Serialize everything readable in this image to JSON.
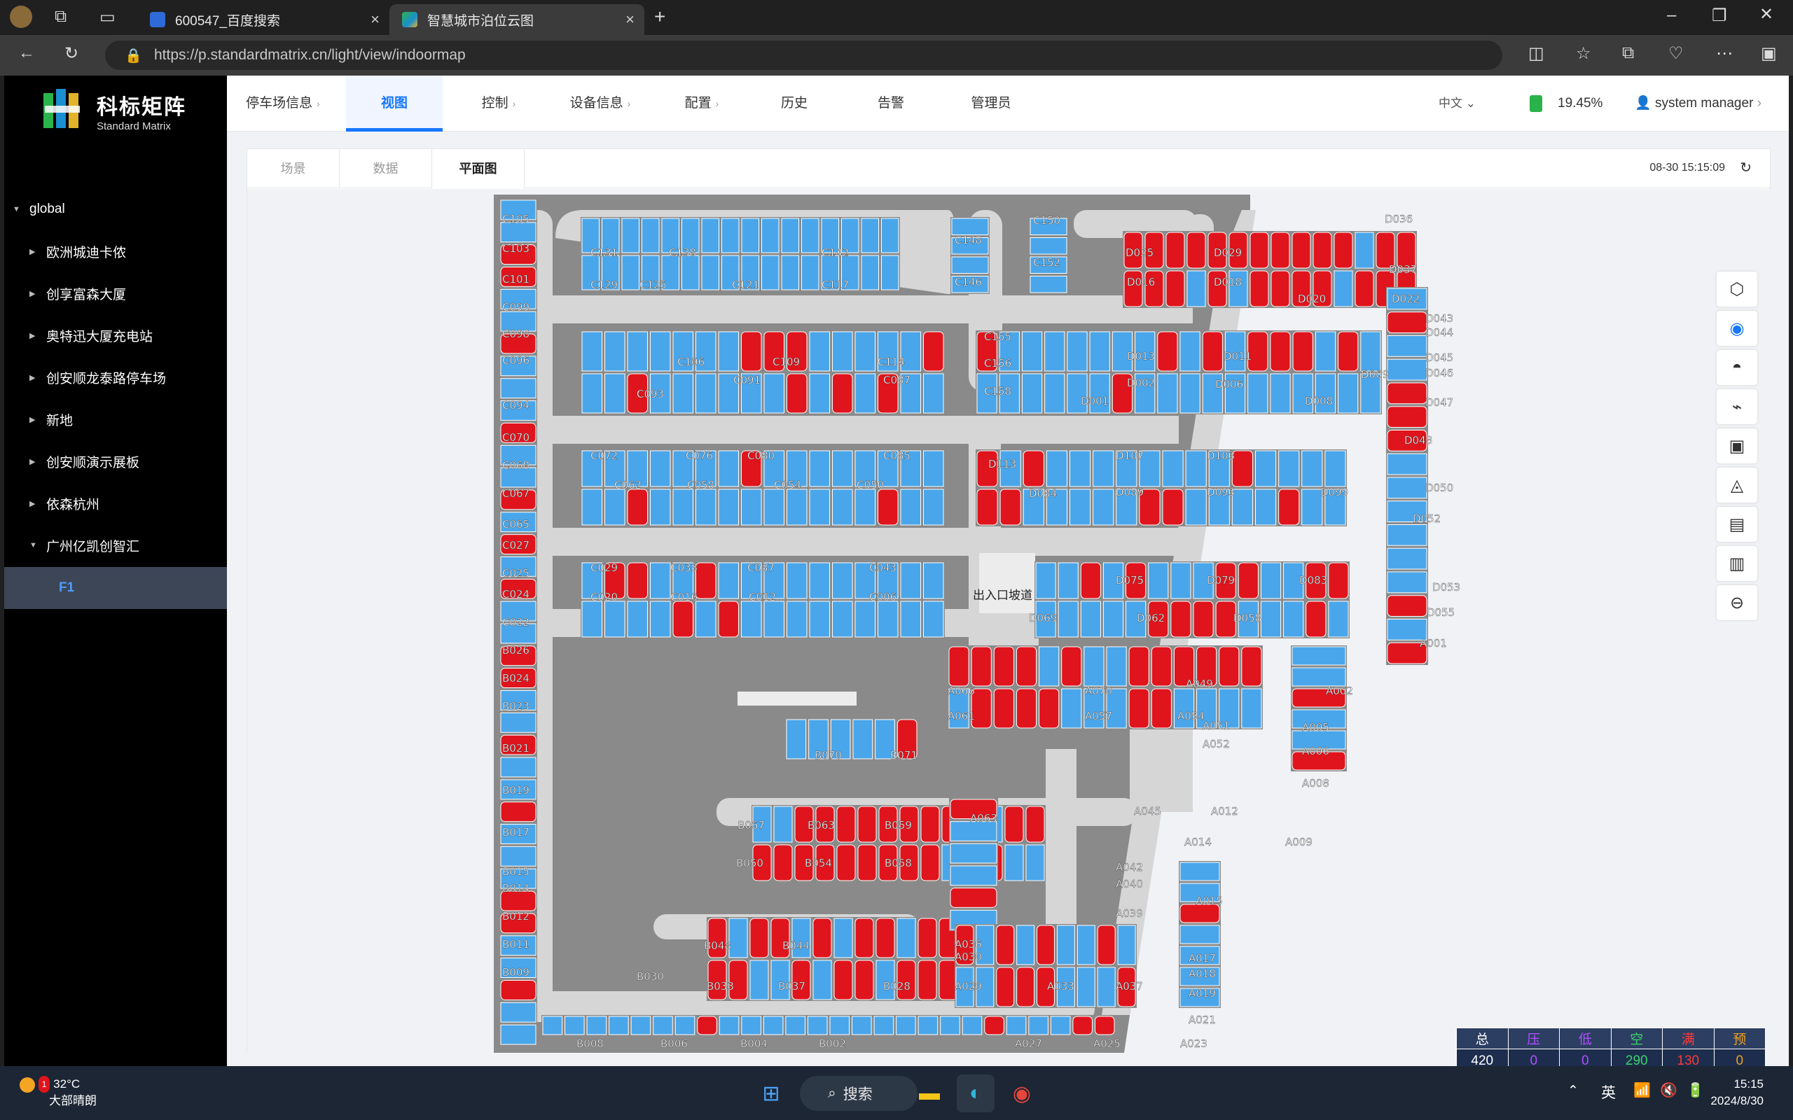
{
  "browser": {
    "tabs": [
      {
        "title": "600547_百度搜索"
      },
      {
        "title": "智慧城市泊位云图"
      }
    ],
    "url": "https://p.standardmatrix.cn/light/view/indoormap"
  },
  "logo": {
    "cn": "科标矩阵",
    "en": "Standard Matrix"
  },
  "sidebar": {
    "root": "global",
    "items": [
      {
        "label": "欧洲城迪卡侬"
      },
      {
        "label": "创享富森大厦"
      },
      {
        "label": "奥特迅大厦充电站"
      },
      {
        "label": "创安顺龙泰路停车场"
      },
      {
        "label": "新地"
      },
      {
        "label": "创安顺演示展板"
      },
      {
        "label": "依森杭州"
      },
      {
        "label": "广州亿凯创智汇"
      }
    ],
    "selected_child": "F1"
  },
  "topnav": {
    "items": [
      {
        "label": "停车场信息",
        "arrow": "›"
      },
      {
        "label": "视图",
        "arrow": ""
      },
      {
        "label": "控制",
        "arrow": "›"
      },
      {
        "label": "设备信息",
        "arrow": "›"
      },
      {
        "label": "配置",
        "arrow": "›"
      },
      {
        "label": "历史",
        "arrow": ""
      },
      {
        "label": "告警",
        "arrow": ""
      },
      {
        "label": "管理员",
        "arrow": ""
      }
    ],
    "lang": "中文",
    "battery": "19.45%",
    "user": "system manager"
  },
  "subtabs": [
    "场景",
    "数据",
    "平面图"
  ],
  "timestamp": "08-30 15:15:09",
  "map": {
    "ramp_label": "出入口坡道",
    "colors": {
      "occupied": "#e0141c",
      "vacant": "#4aa6ea",
      "lane": "#d6d6d6",
      "block": "#8a8a8a"
    },
    "space_labels": [
      "C105",
      "C103",
      "C101",
      "C099",
      "C098",
      "C096",
      "C094",
      "C070",
      "C068",
      "C067",
      "C065",
      "C027",
      "C025",
      "C024",
      "C022",
      "B026",
      "B024",
      "B023",
      "B021",
      "B019",
      "B017",
      "B015",
      "B014",
      "B012",
      "B011",
      "B009",
      "C131",
      "C129",
      "C138",
      "C125",
      "C121",
      "C142",
      "C117",
      "C148",
      "C146",
      "C150",
      "C152",
      "C106",
      "C109",
      "C114",
      "C093",
      "C091",
      "C087",
      "C072",
      "C062",
      "C076",
      "C058",
      "C080",
      "C054",
      "C085",
      "C050",
      "C029",
      "C020",
      "C033",
      "C016",
      "C037",
      "C012",
      "C043",
      "C006",
      "C155",
      "C156",
      "C158",
      "D025",
      "D016",
      "D029",
      "D018",
      "D036",
      "D037",
      "D020",
      "D022",
      "D013",
      "D011",
      "D002",
      "D006",
      "D001",
      "D008",
      "D009",
      "D113",
      "D107",
      "D103",
      "D084",
      "D089",
      "D093",
      "D099",
      "D075",
      "D079",
      "D083",
      "D069",
      "D062",
      "D058",
      "D043",
      "D044",
      "D045",
      "D046",
      "D047",
      "D048",
      "D050",
      "D052",
      "D053",
      "D055",
      "A001",
      "A002",
      "A005",
      "A006",
      "A008",
      "A066",
      "A070",
      "A049",
      "A061",
      "A057",
      "A054",
      "A051",
      "A052",
      "A063",
      "A045",
      "A012",
      "A014",
      "A009",
      "A042",
      "A040",
      "A015",
      "A039",
      "A036",
      "A030",
      "A029",
      "A033",
      "A037",
      "A017",
      "A018",
      "A019",
      "A021",
      "A023",
      "A025",
      "A027",
      "B070",
      "B071",
      "B067",
      "B063",
      "B059",
      "B050",
      "B054",
      "B058",
      "B048",
      "B044",
      "B030",
      "B033",
      "B037",
      "B028",
      "B008",
      "B006",
      "B004",
      "B002"
    ]
  },
  "tools": [
    "3d-view-icon",
    "eye-icon",
    "camera-dome-icon",
    "camera-bullet-icon",
    "screen-icon",
    "lamp-icon",
    "guide-screen-icon",
    "controller-icon",
    "car-icon"
  ],
  "stats": {
    "headers": [
      "总",
      "压",
      "低",
      "空",
      "满",
      "预"
    ],
    "values": [
      "420",
      "0",
      "0",
      "290",
      "130",
      "0"
    ],
    "colors": [
      "#ffffff",
      "#b24fff",
      "#b24fff",
      "#3cd56a",
      "#ff3a3a",
      "#f0a020"
    ]
  },
  "taskbar": {
    "weather_temp": "32°C",
    "weather_desc": "大部晴朗",
    "weather_badge": "1",
    "search_label": "搜索",
    "ime": "英",
    "time": "15:15",
    "date": "2024/8/30"
  }
}
